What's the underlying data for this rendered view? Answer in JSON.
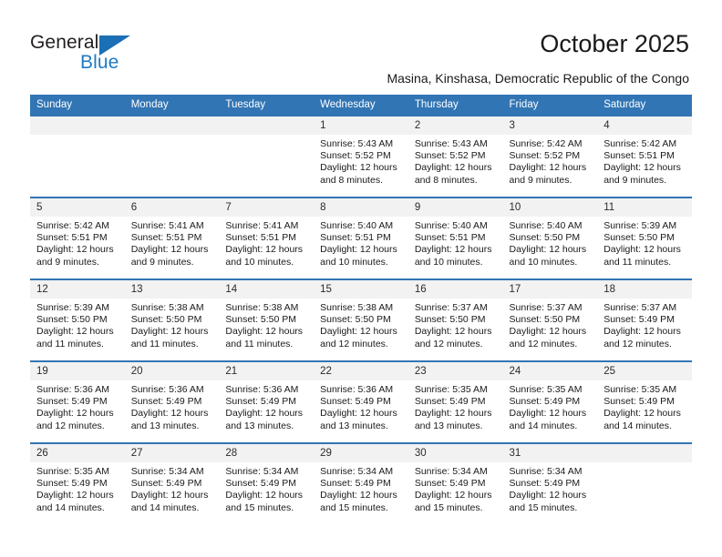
{
  "brand": {
    "name_part1": "General",
    "name_part2": "Blue",
    "accent_color": "#1a6fb5"
  },
  "header": {
    "title": "October 2025",
    "subtitle": "Masina, Kinshasa, Democratic Republic of the Congo"
  },
  "calendar": {
    "header_bg": "#3175b4",
    "daynum_bg": "#f2f2f2",
    "weekday_headers": [
      "Sunday",
      "Monday",
      "Tuesday",
      "Wednesday",
      "Thursday",
      "Friday",
      "Saturday"
    ],
    "weeks": [
      [
        {
          "day": "",
          "empty": true,
          "sunrise": "",
          "sunset": "",
          "daylight": ""
        },
        {
          "day": "",
          "empty": true,
          "sunrise": "",
          "sunset": "",
          "daylight": ""
        },
        {
          "day": "",
          "empty": true,
          "sunrise": "",
          "sunset": "",
          "daylight": ""
        },
        {
          "day": "1",
          "empty": false,
          "sunrise": "Sunrise: 5:43 AM",
          "sunset": "Sunset: 5:52 PM",
          "daylight": "Daylight: 12 hours and 8 minutes."
        },
        {
          "day": "2",
          "empty": false,
          "sunrise": "Sunrise: 5:43 AM",
          "sunset": "Sunset: 5:52 PM",
          "daylight": "Daylight: 12 hours and 8 minutes."
        },
        {
          "day": "3",
          "empty": false,
          "sunrise": "Sunrise: 5:42 AM",
          "sunset": "Sunset: 5:52 PM",
          "daylight": "Daylight: 12 hours and 9 minutes."
        },
        {
          "day": "4",
          "empty": false,
          "sunrise": "Sunrise: 5:42 AM",
          "sunset": "Sunset: 5:51 PM",
          "daylight": "Daylight: 12 hours and 9 minutes."
        }
      ],
      [
        {
          "day": "5",
          "empty": false,
          "sunrise": "Sunrise: 5:42 AM",
          "sunset": "Sunset: 5:51 PM",
          "daylight": "Daylight: 12 hours and 9 minutes."
        },
        {
          "day": "6",
          "empty": false,
          "sunrise": "Sunrise: 5:41 AM",
          "sunset": "Sunset: 5:51 PM",
          "daylight": "Daylight: 12 hours and 9 minutes."
        },
        {
          "day": "7",
          "empty": false,
          "sunrise": "Sunrise: 5:41 AM",
          "sunset": "Sunset: 5:51 PM",
          "daylight": "Daylight: 12 hours and 10 minutes."
        },
        {
          "day": "8",
          "empty": false,
          "sunrise": "Sunrise: 5:40 AM",
          "sunset": "Sunset: 5:51 PM",
          "daylight": "Daylight: 12 hours and 10 minutes."
        },
        {
          "day": "9",
          "empty": false,
          "sunrise": "Sunrise: 5:40 AM",
          "sunset": "Sunset: 5:51 PM",
          "daylight": "Daylight: 12 hours and 10 minutes."
        },
        {
          "day": "10",
          "empty": false,
          "sunrise": "Sunrise: 5:40 AM",
          "sunset": "Sunset: 5:50 PM",
          "daylight": "Daylight: 12 hours and 10 minutes."
        },
        {
          "day": "11",
          "empty": false,
          "sunrise": "Sunrise: 5:39 AM",
          "sunset": "Sunset: 5:50 PM",
          "daylight": "Daylight: 12 hours and 11 minutes."
        }
      ],
      [
        {
          "day": "12",
          "empty": false,
          "sunrise": "Sunrise: 5:39 AM",
          "sunset": "Sunset: 5:50 PM",
          "daylight": "Daylight: 12 hours and 11 minutes."
        },
        {
          "day": "13",
          "empty": false,
          "sunrise": "Sunrise: 5:38 AM",
          "sunset": "Sunset: 5:50 PM",
          "daylight": "Daylight: 12 hours and 11 minutes."
        },
        {
          "day": "14",
          "empty": false,
          "sunrise": "Sunrise: 5:38 AM",
          "sunset": "Sunset: 5:50 PM",
          "daylight": "Daylight: 12 hours and 11 minutes."
        },
        {
          "day": "15",
          "empty": false,
          "sunrise": "Sunrise: 5:38 AM",
          "sunset": "Sunset: 5:50 PM",
          "daylight": "Daylight: 12 hours and 12 minutes."
        },
        {
          "day": "16",
          "empty": false,
          "sunrise": "Sunrise: 5:37 AM",
          "sunset": "Sunset: 5:50 PM",
          "daylight": "Daylight: 12 hours and 12 minutes."
        },
        {
          "day": "17",
          "empty": false,
          "sunrise": "Sunrise: 5:37 AM",
          "sunset": "Sunset: 5:50 PM",
          "daylight": "Daylight: 12 hours and 12 minutes."
        },
        {
          "day": "18",
          "empty": false,
          "sunrise": "Sunrise: 5:37 AM",
          "sunset": "Sunset: 5:49 PM",
          "daylight": "Daylight: 12 hours and 12 minutes."
        }
      ],
      [
        {
          "day": "19",
          "empty": false,
          "sunrise": "Sunrise: 5:36 AM",
          "sunset": "Sunset: 5:49 PM",
          "daylight": "Daylight: 12 hours and 12 minutes."
        },
        {
          "day": "20",
          "empty": false,
          "sunrise": "Sunrise: 5:36 AM",
          "sunset": "Sunset: 5:49 PM",
          "daylight": "Daylight: 12 hours and 13 minutes."
        },
        {
          "day": "21",
          "empty": false,
          "sunrise": "Sunrise: 5:36 AM",
          "sunset": "Sunset: 5:49 PM",
          "daylight": "Daylight: 12 hours and 13 minutes."
        },
        {
          "day": "22",
          "empty": false,
          "sunrise": "Sunrise: 5:36 AM",
          "sunset": "Sunset: 5:49 PM",
          "daylight": "Daylight: 12 hours and 13 minutes."
        },
        {
          "day": "23",
          "empty": false,
          "sunrise": "Sunrise: 5:35 AM",
          "sunset": "Sunset: 5:49 PM",
          "daylight": "Daylight: 12 hours and 13 minutes."
        },
        {
          "day": "24",
          "empty": false,
          "sunrise": "Sunrise: 5:35 AM",
          "sunset": "Sunset: 5:49 PM",
          "daylight": "Daylight: 12 hours and 14 minutes."
        },
        {
          "day": "25",
          "empty": false,
          "sunrise": "Sunrise: 5:35 AM",
          "sunset": "Sunset: 5:49 PM",
          "daylight": "Daylight: 12 hours and 14 minutes."
        }
      ],
      [
        {
          "day": "26",
          "empty": false,
          "sunrise": "Sunrise: 5:35 AM",
          "sunset": "Sunset: 5:49 PM",
          "daylight": "Daylight: 12 hours and 14 minutes."
        },
        {
          "day": "27",
          "empty": false,
          "sunrise": "Sunrise: 5:34 AM",
          "sunset": "Sunset: 5:49 PM",
          "daylight": "Daylight: 12 hours and 14 minutes."
        },
        {
          "day": "28",
          "empty": false,
          "sunrise": "Sunrise: 5:34 AM",
          "sunset": "Sunset: 5:49 PM",
          "daylight": "Daylight: 12 hours and 15 minutes."
        },
        {
          "day": "29",
          "empty": false,
          "sunrise": "Sunrise: 5:34 AM",
          "sunset": "Sunset: 5:49 PM",
          "daylight": "Daylight: 12 hours and 15 minutes."
        },
        {
          "day": "30",
          "empty": false,
          "sunrise": "Sunrise: 5:34 AM",
          "sunset": "Sunset: 5:49 PM",
          "daylight": "Daylight: 12 hours and 15 minutes."
        },
        {
          "day": "31",
          "empty": false,
          "sunrise": "Sunrise: 5:34 AM",
          "sunset": "Sunset: 5:49 PM",
          "daylight": "Daylight: 12 hours and 15 minutes."
        },
        {
          "day": "",
          "empty": true,
          "sunrise": "",
          "sunset": "",
          "daylight": ""
        }
      ]
    ]
  }
}
